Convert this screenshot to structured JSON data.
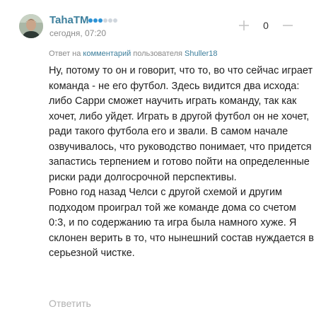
{
  "comment": {
    "author": "TahaTM",
    "rating": {
      "filled": 3,
      "total": 6
    },
    "timestamp": "сегодня, 07:20",
    "votes": {
      "count": "0"
    },
    "reply_info": {
      "prefix": "Ответ на",
      "comment_link": "комментарий",
      "middle": "пользователя",
      "user_link": "Shuller18"
    },
    "paragraphs": [
      "Ну, потому то он и говорит, что то, во что сейчас играет команда - не его футбол. Здесь видится два исхода: либо Сарри сможет научить играть команду, так как хочет, либо уйдет. Играть в другой футбол он не хочет, ради такого футбола его и звали. В самом начале озвучивалось, что руководство понимает, что придется запастись терпением и готово пойти на определенные риски ради долгосрочной перспективы.",
      "Ровно год назад Челси с другой схемой и другим подходом проиграл той же команде дома со счетом 0:3, и по содержанию та игра была намного хуже. Я склонен верить в то, что нынешний состав нуждается в серьезной чистке."
    ],
    "reply_label": "Ответить"
  },
  "colors": {
    "author": "#3d7f9c",
    "link": "#3d7f9c",
    "dot_on": "#2d93d6",
    "dot_off": "#cfd6dd",
    "muted": "#8a8a8a"
  },
  "icons": {
    "avatar": "user-photo",
    "upvote": "plus-icon",
    "downvote": "minus-icon"
  }
}
